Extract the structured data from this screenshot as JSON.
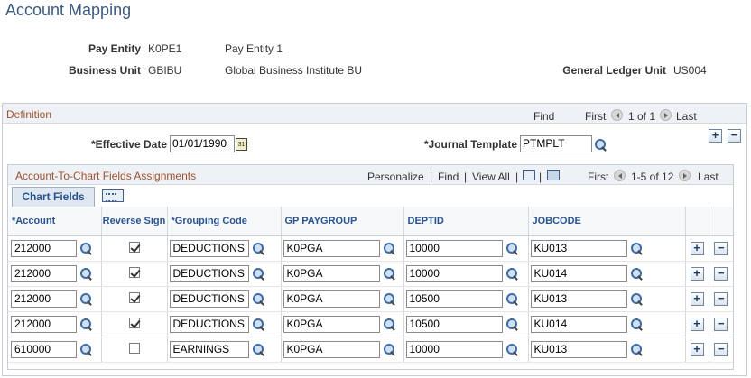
{
  "page": {
    "title": "Account Mapping"
  },
  "header": {
    "pay_entity_label": "Pay Entity",
    "pay_entity_code": "K0PE1",
    "pay_entity_name": "Pay Entity 1",
    "business_unit_label": "Business Unit",
    "business_unit_code": "GBIBU",
    "business_unit_name": "Global Business Institute BU",
    "gl_unit_label": "General Ledger Unit",
    "gl_unit_value": "US004"
  },
  "definition": {
    "title": "Definition",
    "find": "Find",
    "first": "First",
    "range": "1 of 1",
    "last": "Last",
    "effective_date_label": "*Effective Date",
    "effective_date_value": "01/01/1990",
    "journal_template_label": "*Journal Template",
    "journal_template_value": "PTMPLT",
    "add": "+",
    "remove": "−"
  },
  "grid": {
    "title": "Account-To-Chart Fields Assignments",
    "personalize": "Personalize",
    "find": "Find",
    "view_all": "View All",
    "first": "First",
    "range": "1-5 of 12",
    "last": "Last",
    "tab": "Chart Fields",
    "columns": {
      "account": "*Account",
      "reverse_sign": "Reverse Sign",
      "grouping_code": "*Grouping Code",
      "gp_paygroup": "GP PAYGROUP",
      "deptid": "DEPTID",
      "jobcode": "JOBCODE"
    },
    "rows": [
      {
        "account": "212000",
        "reverse": true,
        "grouping": "DEDUCTIONS",
        "paygroup": "K0PGA",
        "deptid": "10000",
        "jobcode": "KU013"
      },
      {
        "account": "212000",
        "reverse": true,
        "grouping": "DEDUCTIONS",
        "paygroup": "K0PGA",
        "deptid": "10000",
        "jobcode": "KU014"
      },
      {
        "account": "212000",
        "reverse": true,
        "grouping": "DEDUCTIONS",
        "paygroup": "K0PGA",
        "deptid": "10500",
        "jobcode": "KU013"
      },
      {
        "account": "212000",
        "reverse": true,
        "grouping": "DEDUCTIONS",
        "paygroup": "K0PGA",
        "deptid": "10500",
        "jobcode": "KU014"
      },
      {
        "account": "610000",
        "reverse": false,
        "grouping": "EARNINGS",
        "paygroup": "K0PGA",
        "deptid": "10000",
        "jobcode": "KU013"
      }
    ],
    "add": "+",
    "remove": "−"
  },
  "colors": {
    "title": "#3d5a80",
    "section_title": "#a0522d",
    "link": "#2a5491"
  }
}
